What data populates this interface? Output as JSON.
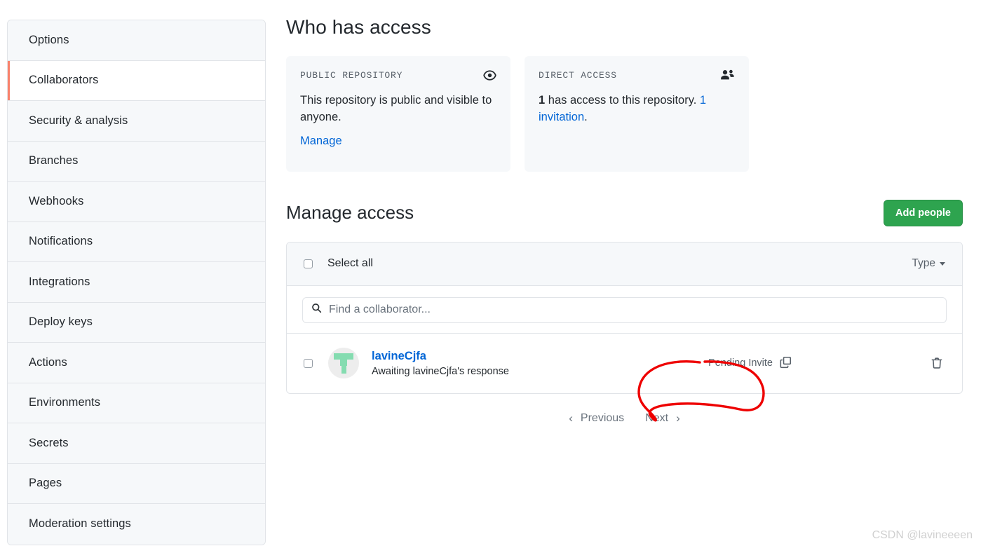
{
  "sidebar": {
    "items": [
      {
        "label": "Options",
        "active": false
      },
      {
        "label": "Collaborators",
        "active": true
      },
      {
        "label": "Security & analysis",
        "active": false
      },
      {
        "label": "Branches",
        "active": false
      },
      {
        "label": "Webhooks",
        "active": false
      },
      {
        "label": "Notifications",
        "active": false
      },
      {
        "label": "Integrations",
        "active": false
      },
      {
        "label": "Deploy keys",
        "active": false
      },
      {
        "label": "Actions",
        "active": false
      },
      {
        "label": "Environments",
        "active": false
      },
      {
        "label": "Secrets",
        "active": false
      },
      {
        "label": "Pages",
        "active": false
      },
      {
        "label": "Moderation settings",
        "active": false
      }
    ]
  },
  "main": {
    "heading": "Who has access",
    "cards": [
      {
        "label": "PUBLIC REPOSITORY",
        "icon": "eye-icon",
        "body": "This repository is public and visible to anyone.",
        "link": "Manage"
      },
      {
        "label": "DIRECT ACCESS",
        "icon": "people-icon",
        "count": "1",
        "body_middle": " has access to this repository. ",
        "link_count": "1",
        "link_text": "invitation",
        "body_end": "."
      }
    ],
    "manage": {
      "heading": "Manage access",
      "add_people_label": "Add people",
      "select_all_label": "Select all",
      "type_filter_label": "Type",
      "search_placeholder": "Find a collaborator...",
      "search_value": "",
      "rows": [
        {
          "username": "lavineCjfa",
          "status_text": "Awaiting lavineCjfa's response",
          "role": "Pending Invite",
          "role_icon": "copy-icon",
          "delete_icon": "trash-icon",
          "checked": false
        }
      ]
    },
    "pagination": {
      "previous": "Previous",
      "next": "Next"
    }
  },
  "annotation": {
    "color": "#ee0000",
    "shape": "hand-drawn-ellipse"
  },
  "watermark": "CSDN @lavineeeen",
  "colors": {
    "accent_green": "#2ea44f",
    "link_blue": "#0366d6",
    "active_marker": "#f9826c",
    "panel_bg": "#f6f8fa",
    "border": "#e1e4e8",
    "avatar_green": "#84dcb0"
  }
}
